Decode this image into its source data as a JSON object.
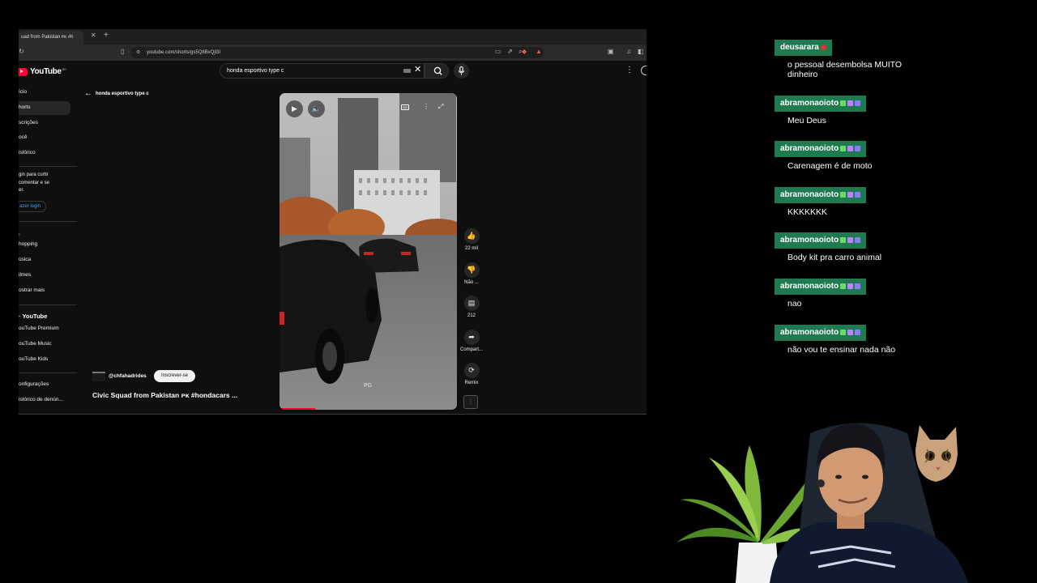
{
  "browser": {
    "tab_title": "uad from Pakistan ᴘᴋ #h",
    "url": "youtube.com/shorts/gs5Q8BxQjl3I"
  },
  "youtube": {
    "logo_text": "YouTube",
    "logo_sup": "BR",
    "search_value": "honda esportivo type c",
    "query_title": "honda esportivo type c"
  },
  "sidebar": {
    "items": [
      {
        "label": "ício"
      },
      {
        "label": "horts"
      },
      {
        "label": "scrições"
      },
      {
        "label": "ocê"
      },
      {
        "label": "istórico"
      }
    ],
    "login_text": "gin para curtir comentar e se er.",
    "login_button": "azer login",
    "explore": [
      {
        "label": "hopping"
      },
      {
        "label": "úsica"
      },
      {
        "label": "ilmes"
      },
      {
        "label": "ostrar mais"
      }
    ],
    "more_title": "YouTube",
    "more_items": [
      {
        "label": "ouTube Premium"
      },
      {
        "label": "ouTube Music"
      },
      {
        "label": "ouTube Kids"
      }
    ],
    "footer_items": [
      {
        "label": "onfigurações"
      },
      {
        "label": "istórico de denún..."
      }
    ]
  },
  "short": {
    "channel": "@chfahadrides",
    "subscribe_label": "Inscrever-se",
    "title": "Civic Squad from Pakistan ᴘᴋ #hondacars ...",
    "watermark": "PG",
    "cc_label": "CC",
    "progress": 0.2
  },
  "actions": {
    "like_count": "22 mil",
    "dislike_label": "Não ...",
    "comments_count": "212",
    "share_label": "Compart...",
    "remix_label": "Remix"
  },
  "chat": [
    {
      "user": "deusarara",
      "text": "o pessoal desembolsa MUITO dinheiro"
    },
    {
      "user": "abramonaoioto",
      "text": "Meu Deus"
    },
    {
      "user": "abramonaoioto",
      "text": "Carenagem é de moto"
    },
    {
      "user": "abramonaoioto",
      "text": "KKKKKKK"
    },
    {
      "user": "abramonaoioto",
      "text": "Body kit pra carro animal"
    },
    {
      "user": "abramonaoioto",
      "text": "nao"
    },
    {
      "user": "abramonaoioto",
      "text": "não vou te ensinar nada não"
    }
  ],
  "colors": {
    "chat_user_bg": "#1f7a4f",
    "yt_red": "#ff0033",
    "link_blue": "#3ea6ff"
  }
}
